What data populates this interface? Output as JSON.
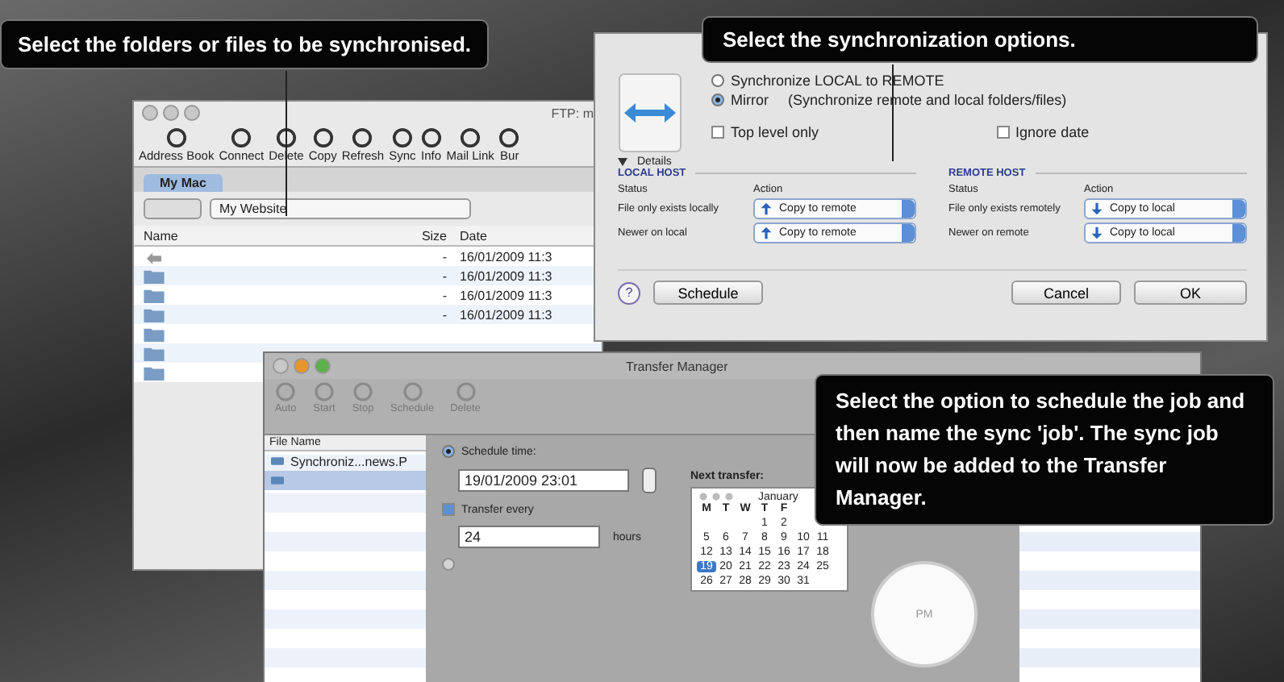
{
  "callouts": [
    {
      "text": "Select the folders or files to be synchronised."
    },
    {
      "text": "Select the synchronization options."
    },
    {
      "text": "Select the option to schedule the job and then name the sync 'job'. The sync job will now be added to the Transfer Manager."
    }
  ],
  "ftp_window": {
    "title": "FTP: m",
    "toolbar": [
      "Address Book",
      "Connect",
      "Delete",
      "Copy",
      "Refresh",
      "Sync",
      "Info",
      "Mail Link",
      "Bur"
    ],
    "tab": {
      "label": "My Mac",
      "selected": true
    },
    "location": "My Website",
    "columns": [
      "Name",
      "Size",
      "Date"
    ],
    "rows": [
      {
        "kind": "parent",
        "size": "-",
        "date": "16/01/2009 11:3"
      },
      {
        "kind": "folder",
        "size": "-",
        "date": "16/01/2009 11:3"
      },
      {
        "kind": "folder",
        "size": "-",
        "date": "16/01/2009 11:3"
      },
      {
        "kind": "folder",
        "size": "-",
        "date": "16/01/2009 11:3"
      },
      {
        "kind": "folder"
      },
      {
        "kind": "folder"
      },
      {
        "kind": "folder"
      }
    ]
  },
  "sync_dialog": {
    "modes": [
      {
        "label": "Synchronize LOCAL to REMOTE",
        "selected": false
      },
      {
        "label": "Mirror",
        "note": "(Synchronize remote and local folders/files)",
        "selected": true
      }
    ],
    "options": [
      {
        "label": "Top level only",
        "checked": false
      },
      {
        "label": "Ignore date",
        "checked": false
      }
    ],
    "details": {
      "label": "Details",
      "expanded": true
    },
    "hosts": [
      {
        "title": "LOCAL HOST",
        "status_heading": "Status",
        "action_heading": "Action",
        "rules": [
          {
            "status": "File only exists locally",
            "action": "Copy to remote",
            "kind": "upload"
          },
          {
            "status": "Newer on local",
            "action": "Copy to remote",
            "kind": "upload"
          }
        ]
      },
      {
        "title": "REMOTE HOST",
        "status_heading": "Status",
        "action_heading": "Action",
        "rules": [
          {
            "status": "File only exists remotely",
            "action": "Copy to local",
            "kind": "download"
          },
          {
            "status": "Newer on remote",
            "action": "Copy to local",
            "kind": "download"
          }
        ]
      }
    ],
    "buttons": {
      "help": "?",
      "schedule": "Schedule",
      "cancel": "Cancel",
      "ok": "OK"
    }
  },
  "transfer_manager": {
    "title": "Transfer Manager",
    "toolbar": [
      "Auto",
      "Start",
      "Stop",
      "Schedule",
      "Delete"
    ],
    "list_heading": "File Name",
    "files": [
      {
        "name": "Synchroniz...news.P",
        "selected": false
      },
      {
        "selected": true
      }
    ],
    "schedule_time": {
      "label": "Schedule time:",
      "selected": true,
      "value": "19/01/2009 23:01"
    },
    "repeat": {
      "label": "Transfer every",
      "checked": true,
      "value": "24",
      "unit": "hours"
    },
    "third_option": {
      "selected": false,
      "disabled": true
    },
    "next_transfer": {
      "label": "Next transfer:",
      "month": "January",
      "weekdays": [
        "M",
        "T",
        "W",
        "T",
        "F"
      ],
      "weeks": [
        [
          {
            "kind": "blank"
          },
          {
            "kind": "blank"
          },
          {
            "kind": "blank"
          },
          {
            "kind": "day",
            "day": "1",
            "selected": false
          },
          {
            "kind": "day",
            "day": "2",
            "selected": false
          },
          {
            "kind": "blank"
          },
          {
            "kind": "blank"
          }
        ],
        [
          {
            "day": "5",
            "selected": false
          },
          {
            "day": "6",
            "selected": false
          },
          {
            "day": "7",
            "selected": false
          },
          {
            "day": "8",
            "selected": false
          },
          {
            "day": "9",
            "selected": false
          },
          {
            "day": "10",
            "selected": false
          },
          {
            "day": "11",
            "selected": false
          }
        ],
        [
          {
            "day": "12",
            "selected": false
          },
          {
            "day": "13",
            "selected": false
          },
          {
            "day": "14",
            "selected": false
          },
          {
            "day": "15",
            "selected": false
          },
          {
            "day": "16",
            "selected": false
          },
          {
            "day": "17",
            "selected": false
          },
          {
            "day": "18",
            "selected": false
          }
        ],
        [
          {
            "day": "19",
            "selected": true
          },
          {
            "day": "20",
            "selected": false
          },
          {
            "day": "21",
            "selected": false
          },
          {
            "day": "22",
            "selected": false
          },
          {
            "day": "23",
            "selected": false
          },
          {
            "day": "24",
            "selected": false
          },
          {
            "day": "25",
            "selected": false
          }
        ],
        [
          {
            "day": "26",
            "selected": false
          },
          {
            "day": "27",
            "selected": false
          },
          {
            "day": "28",
            "selected": false
          },
          {
            "day": "29",
            "selected": false
          },
          {
            "day": "30",
            "selected": false
          },
          {
            "day": "31",
            "selected": false
          }
        ]
      ]
    },
    "clock": {
      "label": "PM"
    }
  }
}
